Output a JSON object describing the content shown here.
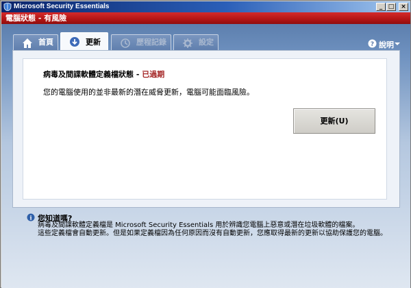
{
  "window": {
    "title": "Microsoft Security Essentials",
    "controls": [
      "minimize",
      "maximize",
      "close"
    ]
  },
  "status_bar": {
    "text": "電腦狀態 - 有風險",
    "color": "#c41d1d"
  },
  "tabs": [
    {
      "label": "首頁",
      "icon": "home-icon",
      "state": "normal"
    },
    {
      "label": "更新",
      "icon": "update-icon",
      "state": "active"
    },
    {
      "label": "歷程記錄",
      "icon": "history-icon",
      "state": "disabled"
    },
    {
      "label": "設定",
      "icon": "gear-icon",
      "state": "disabled"
    }
  ],
  "help": {
    "label": "說明"
  },
  "update_panel": {
    "status_label": "病毒及間諜軟體定義檔狀態 - ",
    "status_value": "已過期",
    "description": "您的電腦使用的並非最新的潛在威脅更新，電腦可能面臨風險。",
    "button_label": "更新(U)"
  },
  "tip": {
    "title": "您知道嗎?",
    "text_line1": "病毒及間諜軟體定義檔是 Microsoft Security Essentials 用於辨識您電腦上惡意或潛在垃圾軟體的檔案。",
    "text_line2": "這些定義檔會自動更新。但是如果定義檔因為任何原因而沒有自動更新，您應取得最新的更新以協助保護您的電腦。"
  },
  "colors": {
    "accent": "#5f7ead",
    "danger": "#a32323",
    "title_bar": "#0a246a"
  }
}
